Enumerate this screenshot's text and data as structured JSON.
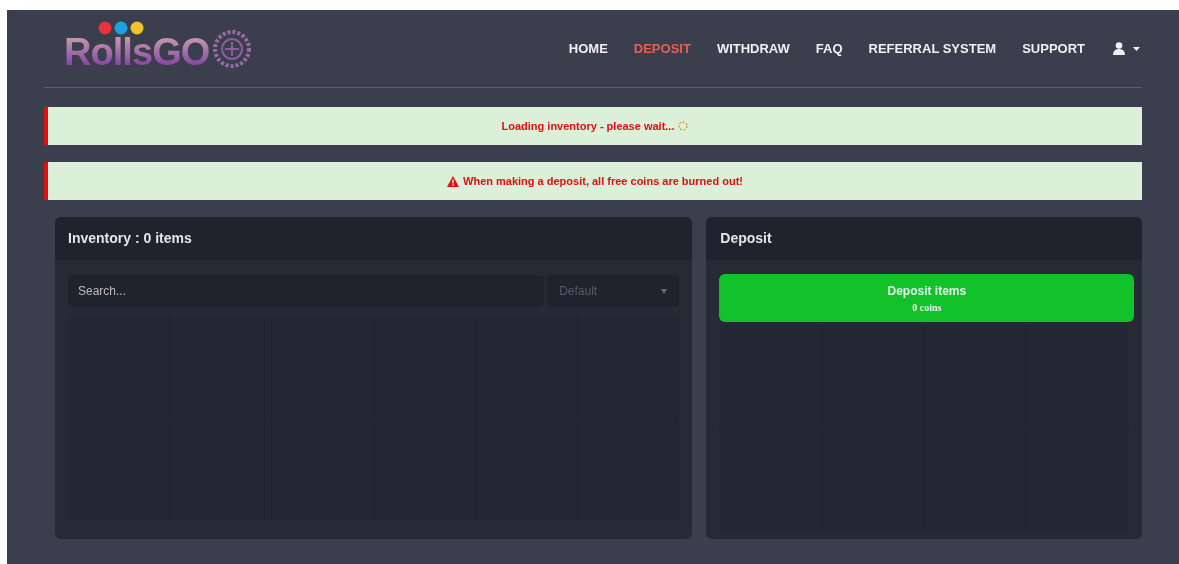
{
  "logo": {
    "text": "RollsGO"
  },
  "nav": [
    {
      "label": "HOME",
      "selected": false
    },
    {
      "label": "DEPOSIT",
      "selected": true
    },
    {
      "label": "WITHDRAW",
      "selected": false
    },
    {
      "label": "FAQ",
      "selected": false
    },
    {
      "label": "REFERRAL SYSTEM",
      "selected": false
    },
    {
      "label": "SUPPORT",
      "selected": false
    }
  ],
  "alerts": [
    {
      "kind": "loading",
      "text": "Loading inventory - please wait..."
    },
    {
      "kind": "warning",
      "text": "When making a deposit, all free coins are burned out!"
    }
  ],
  "inventory": {
    "title": "Inventory : 0 items",
    "search": {
      "placeholder": "Search..."
    },
    "sort": {
      "value": "Default"
    }
  },
  "deposit": {
    "title": "Deposit",
    "button": {
      "label": "Deposit items",
      "sublabel": "0 coins"
    }
  }
}
